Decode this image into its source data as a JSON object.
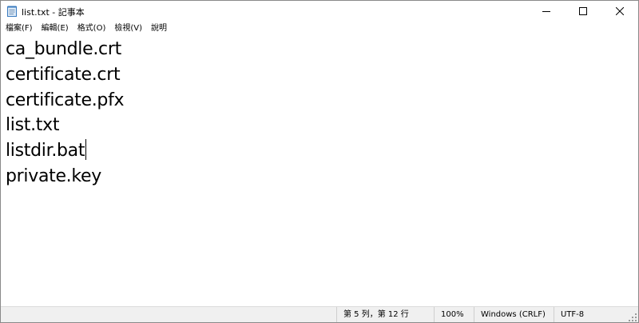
{
  "window": {
    "title": "list.txt - 記事本",
    "app_icon": "notepad-icon",
    "controls": {
      "minimize_icon": "minimize-icon",
      "maximize_icon": "maximize-icon",
      "close_icon": "close-icon"
    }
  },
  "menu": {
    "items": [
      {
        "label": "檔案(F)"
      },
      {
        "label": "編輯(E)"
      },
      {
        "label": "格式(O)"
      },
      {
        "label": "檢視(V)"
      },
      {
        "label": "說明"
      }
    ]
  },
  "editor": {
    "lines": [
      "ca_bundle.crt",
      "certificate.crt",
      "certificate.pfx",
      "list.txt",
      "listdir.bat",
      "private.key"
    ],
    "caret_line": 5
  },
  "statusbar": {
    "position": "第 5 列，第 12 行",
    "zoom": "100%",
    "line_ending": "Windows (CRLF)",
    "encoding": "UTF-8"
  },
  "colors": {
    "background": "#ffffff",
    "text": "#000000",
    "statusbar_bg": "#f0f0f0",
    "border": "#8a8a8a"
  }
}
